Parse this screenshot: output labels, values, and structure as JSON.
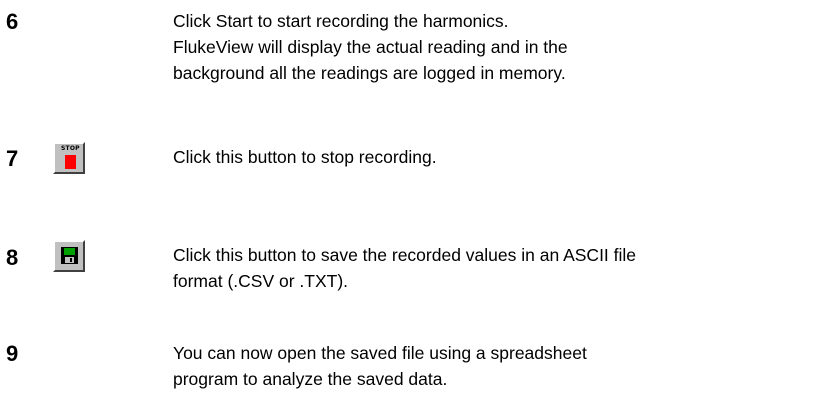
{
  "steps": [
    {
      "number": "6",
      "lines": [
        "Click Start to start recording the harmonics.",
        "FlukeView will display the actual reading and in the",
        "background all the readings are logged in memory."
      ]
    },
    {
      "number": "7",
      "icon": "stop-record-icon",
      "icon_label": "STOP",
      "lines": [
        "Click this button to stop recording."
      ]
    },
    {
      "number": "8",
      "icon": "save-disk-icon",
      "lines": [
        "Click this button to save the recorded values in an ASCII file",
        "format (.CSV or .TXT)."
      ]
    },
    {
      "number": "9",
      "lines": [
        "You can now open the saved file using a spreadsheet",
        "program to analyze the saved data."
      ]
    }
  ],
  "colors": {
    "stop_square": "#ff0000",
    "disk_body": "#000000",
    "disk_label": "#00a000",
    "button_face": "#c0c0c0"
  }
}
